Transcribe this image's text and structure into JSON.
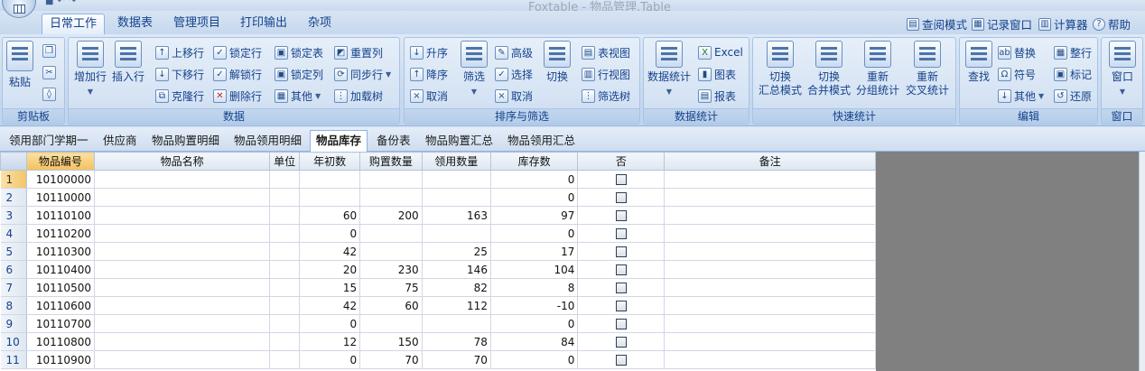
{
  "window": {
    "title": "Foxtable - 物品管理.Table"
  },
  "ribbon_tabs": [
    "日常工作",
    "数据表",
    "管理项目",
    "打印输出",
    "杂项"
  ],
  "active_tab": "日常工作",
  "right_tools": [
    {
      "label": "查阅模式",
      "icon": "view-mode-icon"
    },
    {
      "label": "记录窗口",
      "icon": "record-window-icon"
    },
    {
      "label": "计算器",
      "icon": "calculator-icon"
    },
    {
      "label": "帮助",
      "icon": "help-icon"
    }
  ],
  "groups": {
    "clipboard": {
      "caption": "剪贴板",
      "paste": "粘贴"
    },
    "data": {
      "caption": "数据",
      "add_row": "增加行",
      "insert_row": "插入行",
      "items": [
        "上移行",
        "锁定行",
        "锁定表",
        "重置列",
        "下移行",
        "解锁行",
        "锁定列",
        "同步行",
        "克隆行",
        "删除行",
        "其他",
        "加载树"
      ]
    },
    "sort_filter": {
      "caption": "排序与筛选",
      "items": [
        "升序",
        "降序",
        "取消",
        "高级",
        "选择",
        "取消"
      ],
      "filter": "筛选",
      "toggle": "切换",
      "views": [
        "表视图",
        "行视图",
        "筛选树"
      ]
    },
    "data_stats": {
      "caption": "数据统计",
      "stats": "数据统计",
      "items": [
        "Excel",
        "图表",
        "报表"
      ]
    },
    "quick_stats": {
      "caption": "快速统计",
      "buttons": [
        {
          "l1": "切换",
          "l2": "汇总模式"
        },
        {
          "l1": "切换",
          "l2": "合并模式"
        },
        {
          "l1": "重新",
          "l2": "分组统计"
        },
        {
          "l1": "重新",
          "l2": "交叉统计"
        }
      ]
    },
    "edit": {
      "caption": "编辑",
      "find": "查找",
      "items": [
        "替换",
        "整行",
        "符号",
        "标记",
        "其他",
        "还原"
      ]
    },
    "window": {
      "caption": "窗口",
      "label": "窗口"
    }
  },
  "sheet_tabs": [
    "领用部门学期一",
    "供应商",
    "物品购置明细",
    "物品领用明细",
    "物品库存",
    "备份表",
    "物品购置汇总",
    "物品领用汇总"
  ],
  "active_sheet": "物品库存",
  "columns": [
    "物品编号",
    "物品名称",
    "单位",
    "年初数",
    "购置数量",
    "领用数量",
    "库存数",
    "否",
    "备注"
  ],
  "rows": [
    {
      "n": "1",
      "code": "10100000",
      "name": "",
      "unit": "",
      "start": "",
      "bought": "",
      "used": "",
      "stock": "0",
      "flag": false,
      "note": ""
    },
    {
      "n": "2",
      "code": "10110000",
      "name": "",
      "unit": "",
      "start": "",
      "bought": "",
      "used": "",
      "stock": "0",
      "flag": false,
      "note": ""
    },
    {
      "n": "3",
      "code": "10110100",
      "name": "",
      "unit": "",
      "start": "60",
      "bought": "200",
      "used": "163",
      "stock": "97",
      "flag": false,
      "note": ""
    },
    {
      "n": "4",
      "code": "10110200",
      "name": "",
      "unit": "",
      "start": "0",
      "bought": "",
      "used": "",
      "stock": "0",
      "flag": false,
      "note": ""
    },
    {
      "n": "5",
      "code": "10110300",
      "name": "",
      "unit": "",
      "start": "42",
      "bought": "",
      "used": "25",
      "stock": "17",
      "flag": false,
      "note": ""
    },
    {
      "n": "6",
      "code": "10110400",
      "name": "",
      "unit": "",
      "start": "20",
      "bought": "230",
      "used": "146",
      "stock": "104",
      "flag": false,
      "note": ""
    },
    {
      "n": "7",
      "code": "10110500",
      "name": "",
      "unit": "",
      "start": "15",
      "bought": "75",
      "used": "82",
      "stock": "8",
      "flag": false,
      "note": ""
    },
    {
      "n": "8",
      "code": "10110600",
      "name": "",
      "unit": "",
      "start": "42",
      "bought": "60",
      "used": "112",
      "stock": "-10",
      "flag": false,
      "note": ""
    },
    {
      "n": "9",
      "code": "10110700",
      "name": "",
      "unit": "",
      "start": "0",
      "bought": "",
      "used": "",
      "stock": "0",
      "flag": false,
      "note": ""
    },
    {
      "n": "10",
      "code": "10110800",
      "name": "",
      "unit": "",
      "start": "12",
      "bought": "150",
      "used": "78",
      "stock": "84",
      "flag": false,
      "note": ""
    },
    {
      "n": "11",
      "code": "10110900",
      "name": "",
      "unit": "",
      "start": "0",
      "bought": "70",
      "used": "70",
      "stock": "0",
      "flag": false,
      "note": ""
    }
  ]
}
